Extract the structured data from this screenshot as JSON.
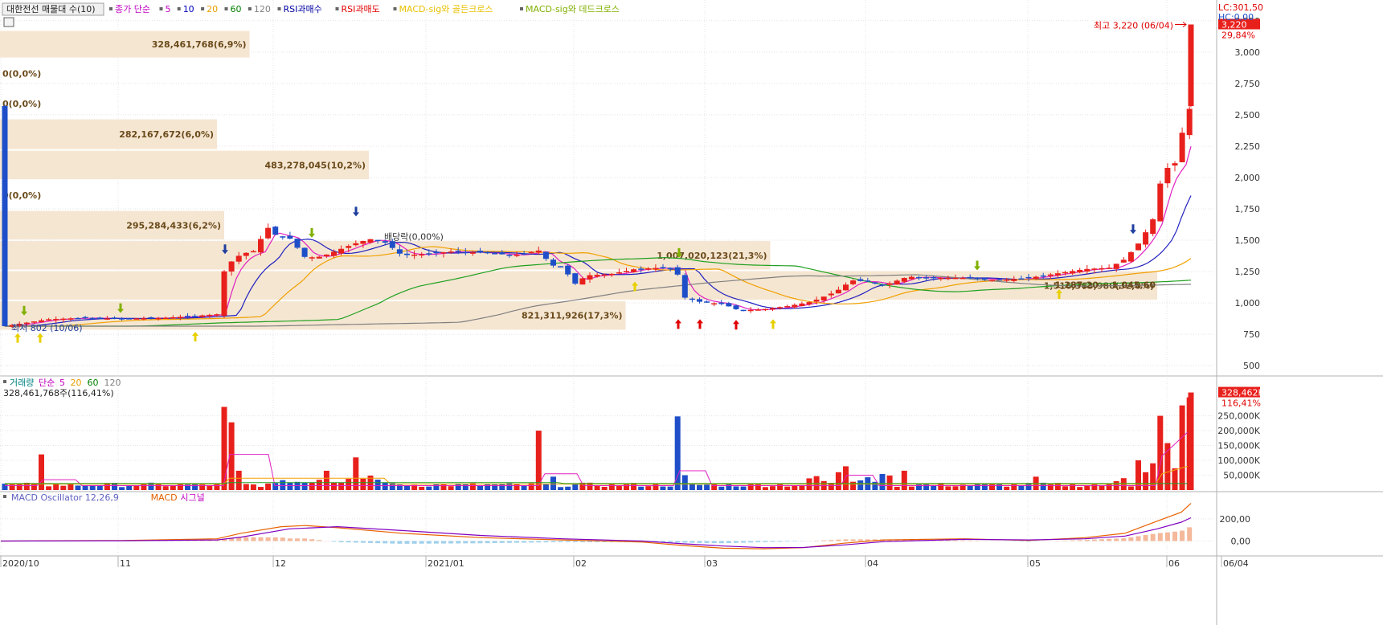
{
  "title_stock": "대한전선 매물대 수(10)",
  "price_legend": [
    {
      "text": "종가 단순",
      "color": "#c000c0"
    },
    {
      "text": "5",
      "color": "#c000c0"
    },
    {
      "text": "10",
      "color": "#0000c0"
    },
    {
      "text": "20",
      "color": "#e8a000"
    },
    {
      "text": "60",
      "color": "#008000"
    },
    {
      "text": "120",
      "color": "#808080"
    },
    {
      "text": "RSI과매수",
      "color": "#0000a0"
    },
    {
      "text": "RSI과매도",
      "color": "#e00000"
    },
    {
      "text": "MACD-sig와 골든크로스",
      "color": "#e8c000"
    },
    {
      "text": "MACD-sig와 데드크로스",
      "color": "#80b000"
    }
  ],
  "lc_label": "LC:301,50",
  "hc_label": "HC:0,00",
  "max_label": "최고 3,220 (06/04)",
  "min_label": "최저 802 (10/06)",
  "last_price_badge": "3,220",
  "last_pct_badge": "29,84%",
  "dividend_label": "배당락(0,00%)",
  "range_label": "1,287,20 ~ 1,045,60",
  "volume_legend": [
    {
      "text": "거래량",
      "color": "#008080"
    },
    {
      "text": "단순",
      "color": "#c000c0"
    },
    {
      "text": "5",
      "color": "#c000c0"
    },
    {
      "text": "20",
      "color": "#e8a000"
    },
    {
      "text": "60",
      "color": "#008000"
    },
    {
      "text": "120",
      "color": "#808080"
    }
  ],
  "volume_info": "328,461,768주(116,41%)",
  "volume_badge": "328,462K",
  "volume_pct_badge": "116,41%",
  "macd_legend": [
    {
      "text": "MACD Oscillator 12,26,9",
      "color": "#6060c0"
    },
    {
      "text": "MACD",
      "color": "#e06000"
    },
    {
      "text": "시그널",
      "color": "#c000c0"
    }
  ],
  "colors": {
    "up": "#e8201c",
    "down": "#1f4fc8",
    "profile": "#f5e6d2",
    "grid": "#e4e4e4",
    "ma5": "#e020c0",
    "ma10": "#2020c0",
    "ma20": "#f0a000",
    "ma60": "#20a020",
    "ma120": "#808080"
  },
  "chart_data": {
    "type": "candlestick",
    "x_ticks": [
      "2020/10",
      "11",
      "12",
      "2021/01",
      "02",
      "03",
      "04",
      "05",
      "06",
      "06/04"
    ],
    "price_axis": {
      "ticks": [
        "500",
        "750",
        "1,000",
        "1,250",
        "1,500",
        "1,750",
        "2,000",
        "2,250",
        "2,500",
        "2,750",
        "3,000",
        "3,250"
      ],
      "ylim": [
        450,
        3300
      ]
    },
    "volume_axis": {
      "ticks": [
        "50,000K",
        "100,000K",
        "150,000K",
        "200,000K",
        "250,000K"
      ],
      "ylim": [
        0,
        330000
      ]
    },
    "macd_axis": {
      "ticks": [
        "0,00",
        "200,00"
      ],
      "ylim": [
        -120,
        330
      ]
    },
    "volume_profile": [
      {
        "label": "328,461,768(6,9%)",
        "price_low": 2950,
        "price_high": 3175,
        "share": 6.9
      },
      {
        "label": "0(0,0%)",
        "price_low": 2710,
        "price_high": 2950,
        "share": 0
      },
      {
        "label": "0(0,0%)",
        "price_low": 2470,
        "price_high": 2710,
        "share": 0
      },
      {
        "label": "282,167,672(6,0%)",
        "price_low": 2220,
        "price_high": 2470,
        "share": 6.0
      },
      {
        "label": "483,278,045(10,2%)",
        "price_low": 1980,
        "price_high": 2220,
        "share": 10.2
      },
      {
        "label": "0(0,0%)",
        "price_low": 1740,
        "price_high": 1980,
        "share": 0
      },
      {
        "label": "295,284,433(6,2%)",
        "price_low": 1500,
        "price_high": 1740,
        "share": 6.2
      },
      {
        "label": "1,007,020,123(21,3%)",
        "price_low": 1260,
        "price_high": 1500,
        "share": 21.3
      },
      {
        "label": "1,516,363,980(32,0%)",
        "price_low": 1020,
        "price_high": 1260,
        "share": 32.0
      },
      {
        "label": "821,311,926(17,3%)",
        "price_low": 780,
        "price_high": 1020,
        "share": 17.3
      }
    ]
  }
}
